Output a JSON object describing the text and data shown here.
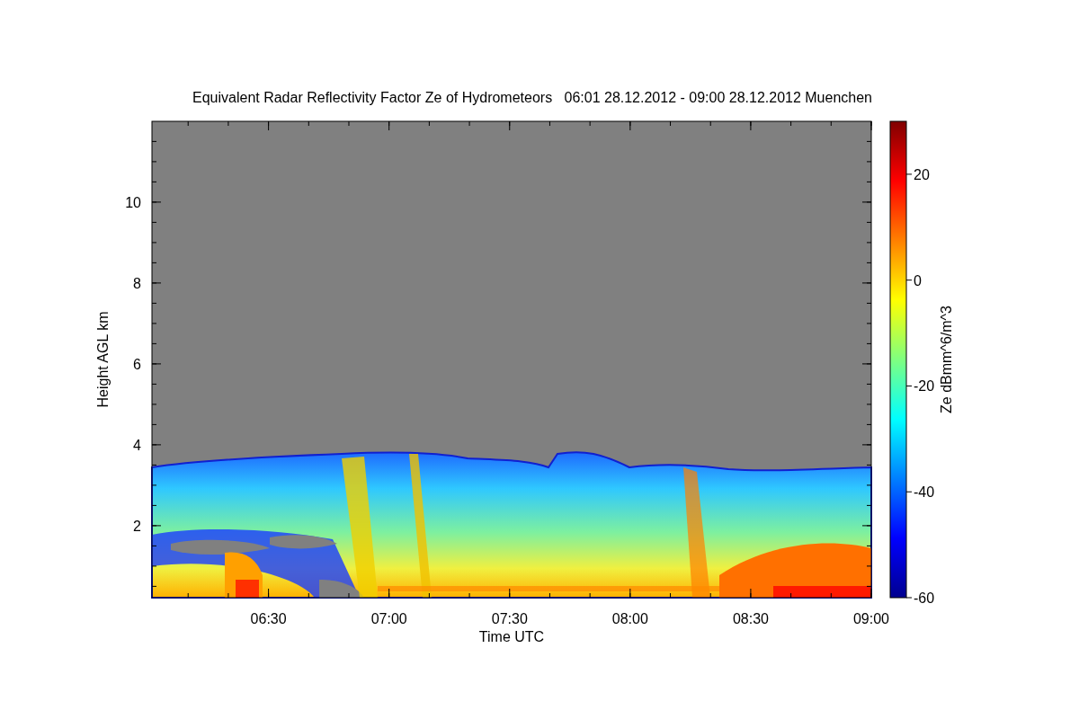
{
  "title": "Equivalent Radar Reflectivity Factor Ze of Hydrometeors   06:01 28.12.2012 - 09:00 28.12.2012 Muenchen",
  "x_axis": {
    "label": "Time UTC",
    "ticks": [
      "06:30",
      "07:00",
      "07:30",
      "08:00",
      "08:30",
      "09:00"
    ]
  },
  "y_axis": {
    "label": "Height AGL km",
    "ticks": [
      "10",
      "8",
      "6",
      "4",
      "2"
    ]
  },
  "colorbar": {
    "label": "Ze dBmm^6/m^3",
    "ticks": [
      "20",
      "0",
      "-20",
      "-40",
      "-60"
    ]
  }
}
